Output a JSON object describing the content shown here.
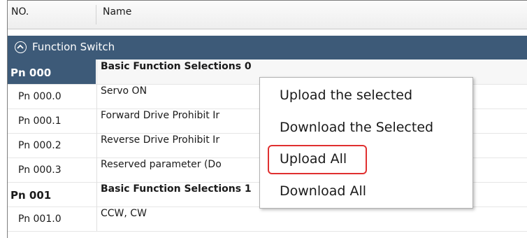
{
  "table": {
    "columns": {
      "no": "NO.",
      "name": "Name"
    },
    "group": {
      "label": "Function Switch"
    },
    "rows": [
      {
        "no": "Pn 000",
        "name": "Basic Function Selections 0",
        "type": "param",
        "selected": true
      },
      {
        "no": "Pn 000.0",
        "name": "Servo ON",
        "type": "sub"
      },
      {
        "no": "Pn 000.1",
        "name": "Forward Drive Prohibit Ir",
        "type": "sub"
      },
      {
        "no": "Pn 000.2",
        "name": "Reverse Drive Prohibit Ir",
        "type": "sub"
      },
      {
        "no": "Pn 000.3",
        "name": "Reserved parameter (Do",
        "type": "sub"
      },
      {
        "no": "Pn 001",
        "name": "Basic Function Selections 1",
        "type": "param"
      },
      {
        "no": "Pn 001.0",
        "name": "CCW, CW",
        "type": "sub"
      }
    ]
  },
  "context_menu": {
    "items": [
      "Upload the selected",
      "Download the Selected",
      "Upload All",
      "Download All"
    ],
    "highlighted_index": 2,
    "highlight_color": "#e03030"
  },
  "colors": {
    "group_header": "#3d5a78",
    "selected_cell": "#3d5a78"
  }
}
